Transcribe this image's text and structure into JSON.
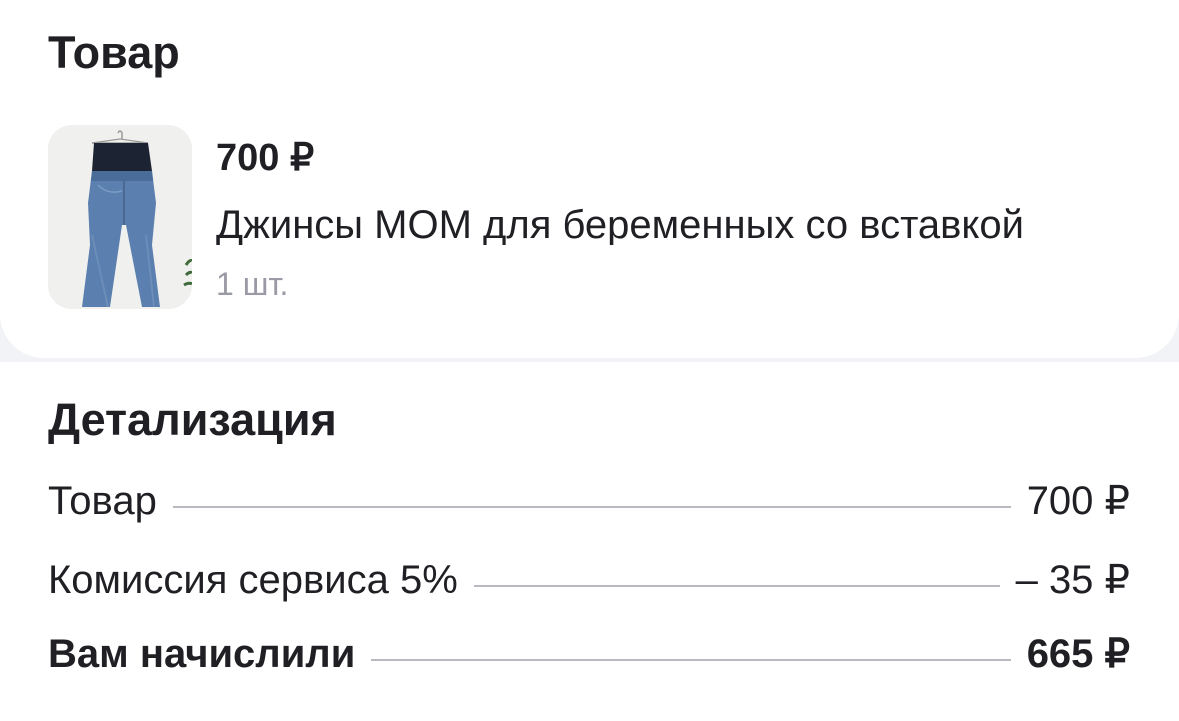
{
  "product_section": {
    "title": "Товар",
    "item": {
      "price": "700 ₽",
      "name": "Джинсы MOM для беременных со вставкой",
      "quantity": "1 шт.",
      "image_icon": "jeans-photo"
    }
  },
  "details_section": {
    "title": "Детализация",
    "rows": [
      {
        "label": "Товар",
        "value": "700 ₽",
        "bold": false
      },
      {
        "label": "Комиссия сервиса 5%",
        "value": "– 35 ₽",
        "bold": false
      },
      {
        "label": "Вам начислили",
        "value": "665 ₽",
        "bold": true
      }
    ]
  },
  "colors": {
    "background": "#f2f3f6",
    "card": "#ffffff",
    "text": "#1f1f24",
    "muted": "#9a9aa6",
    "divider": "#b9b9bf"
  }
}
